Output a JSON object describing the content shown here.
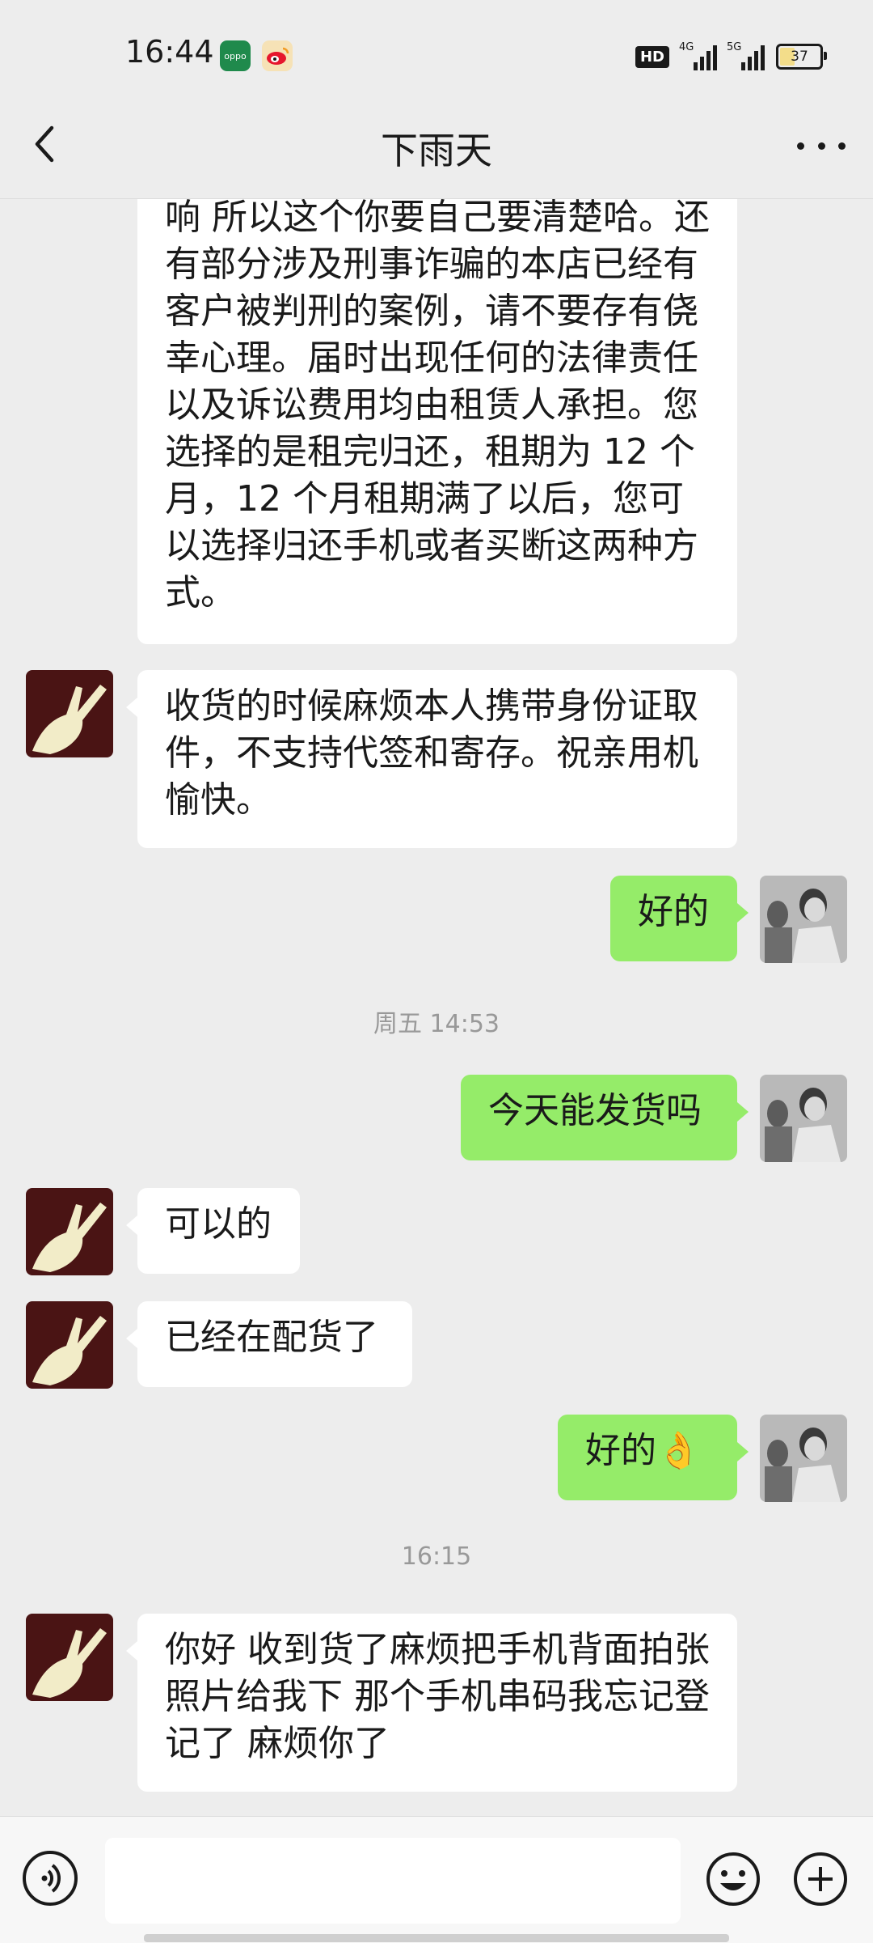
{
  "status_bar": {
    "time": "16:44",
    "app1_label": "oppo",
    "hd": "HD",
    "net1": "4G",
    "net2": "5G",
    "battery": "37"
  },
  "header": {
    "title": "下雨天"
  },
  "messages": [
    {
      "side": "in",
      "text": "响 所以这个你要自己要清楚哈。还\n有部分涉及刑事诈骗的本店已经有\n客户被判刑的案例，请不要存有侥\n幸心理。届时出现任何的法律责任\n以及诉讼费用均由租赁人承担。您\n选择的是租完归还，租期为 12 个\n月，12 个月租期满了以后，您可\n以选择归还手机或者买断这两种方\n式。"
    },
    {
      "side": "in",
      "text": "收货的时候麻烦本人携带身份证取\n件，不支持代签和寄存。祝亲用机\n愉快。"
    },
    {
      "side": "out",
      "text": "好的"
    },
    {
      "side": "out",
      "text": "今天能发货吗"
    },
    {
      "side": "in",
      "text": "可以的"
    },
    {
      "side": "in",
      "text": "已经在配货了"
    },
    {
      "side": "out",
      "text": "好的👌"
    },
    {
      "side": "in",
      "text": "你好 收到货了麻烦把手机背面拍张\n照片给我下 那个手机串码我忘记登\n记了 麻烦你了"
    }
  ],
  "timestamps": [
    "周五 14:53",
    "16:15"
  ],
  "colors": {
    "background": "#ededed",
    "outgoing_bubble": "#95ec69",
    "incoming_bubble": "#ffffff"
  }
}
